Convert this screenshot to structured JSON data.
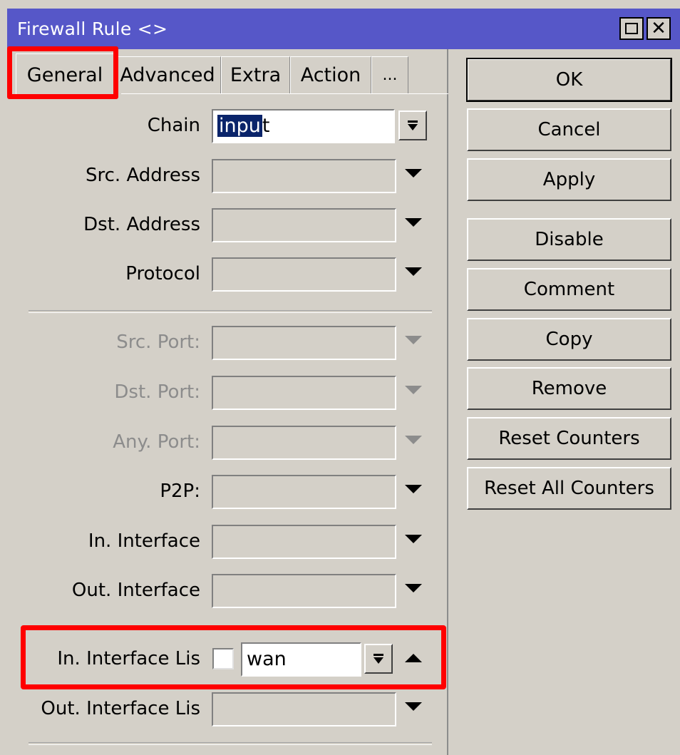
{
  "window": {
    "title": "Firewall Rule <>"
  },
  "tabs": [
    {
      "label": "General",
      "active": true
    },
    {
      "label": "Advanced"
    },
    {
      "label": "Extra"
    },
    {
      "label": "Action"
    },
    {
      "label": "..."
    }
  ],
  "fields": {
    "chain": {
      "label": "Chain",
      "value_selected": "inpu",
      "value_rest": "t"
    },
    "src_address": {
      "label": "Src. Address",
      "value": ""
    },
    "dst_address": {
      "label": "Dst. Address",
      "value": ""
    },
    "protocol": {
      "label": "Protocol",
      "value": ""
    },
    "src_port": {
      "label": "Src. Port:",
      "value": "",
      "disabled": true
    },
    "dst_port": {
      "label": "Dst. Port:",
      "value": "",
      "disabled": true
    },
    "any_port": {
      "label": "Any. Port:",
      "value": "",
      "disabled": true
    },
    "p2p": {
      "label": "P2P:",
      "value": ""
    },
    "in_interface": {
      "label": "In. Interface",
      "value": ""
    },
    "out_interface": {
      "label": "Out. Interface",
      "value": ""
    },
    "in_interface_list": {
      "label": "In. Interface Lis",
      "value": "wan",
      "negate_checked": false
    },
    "out_interface_list": {
      "label": "Out. Interface Lis",
      "value": ""
    }
  },
  "buttons": {
    "ok": "OK",
    "cancel": "Cancel",
    "apply": "Apply",
    "disable": "Disable",
    "comment": "Comment",
    "copy": "Copy",
    "remove": "Remove",
    "reset_counters": "Reset Counters",
    "reset_all_counters": "Reset All Counters"
  },
  "colors": {
    "titlebar": "#5657c8",
    "highlight": "#ff0000",
    "dialog_bg": "#d4d0c8"
  }
}
